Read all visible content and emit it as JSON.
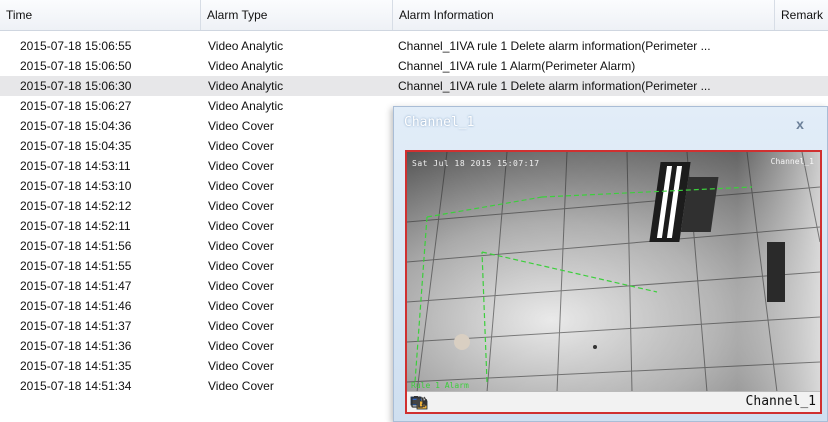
{
  "table": {
    "columns": [
      "Time",
      "Alarm Type",
      "Alarm Information",
      "Remark"
    ],
    "rows": [
      {
        "time": "2015-07-18 15:06:55",
        "type": "Video Analytic",
        "info": "Channel_1IVA rule 1 Delete alarm information(Perimeter ...",
        "remark": ""
      },
      {
        "time": "2015-07-18 15:06:50",
        "type": "Video Analytic",
        "info": "Channel_1IVA rule 1 Alarm(Perimeter Alarm)",
        "remark": ""
      },
      {
        "time": "2015-07-18 15:06:30",
        "type": "Video Analytic",
        "info": "Channel_1IVA rule 1 Delete alarm information(Perimeter ...",
        "remark": ""
      },
      {
        "time": "2015-07-18 15:06:27",
        "type": "Video Analytic",
        "info": "",
        "remark": ""
      },
      {
        "time": "2015-07-18 15:04:36",
        "type": "Video Cover",
        "info": "",
        "remark": ""
      },
      {
        "time": "2015-07-18 15:04:35",
        "type": "Video Cover",
        "info": "",
        "remark": ""
      },
      {
        "time": "2015-07-18 14:53:11",
        "type": "Video Cover",
        "info": "",
        "remark": ""
      },
      {
        "time": "2015-07-18 14:53:10",
        "type": "Video Cover",
        "info": "",
        "remark": ""
      },
      {
        "time": "2015-07-18 14:52:12",
        "type": "Video Cover",
        "info": "",
        "remark": ""
      },
      {
        "time": "2015-07-18 14:52:11",
        "type": "Video Cover",
        "info": "",
        "remark": ""
      },
      {
        "time": "2015-07-18 14:51:56",
        "type": "Video Cover",
        "info": "",
        "remark": ""
      },
      {
        "time": "2015-07-18 14:51:55",
        "type": "Video Cover",
        "info": "",
        "remark": ""
      },
      {
        "time": "2015-07-18 14:51:47",
        "type": "Video Cover",
        "info": "",
        "remark": ""
      },
      {
        "time": "2015-07-18 14:51:46",
        "type": "Video Cover",
        "info": "",
        "remark": ""
      },
      {
        "time": "2015-07-18 14:51:37",
        "type": "Video Cover",
        "info": "",
        "remark": ""
      },
      {
        "time": "2015-07-18 14:51:36",
        "type": "Video Cover",
        "info": "",
        "remark": ""
      },
      {
        "time": "2015-07-18 14:51:35",
        "type": "Video Cover",
        "info": "",
        "remark": ""
      },
      {
        "time": "2015-07-18 14:51:34",
        "type": "Video Cover",
        "info": "",
        "remark": ""
      }
    ],
    "selected_row": 2
  },
  "popup": {
    "title": "Channel_1",
    "close_label": "x",
    "video_label": "Channel_1",
    "osd_datetime": "Sat Jul 18 2015 15:07:17",
    "osd_channel": "Channel_1",
    "osd_rule": "Rule 1 Alarm",
    "toolbar_icons": [
      "talk-icon",
      "speaker-icon",
      "camera-icon"
    ]
  },
  "colors": {
    "video_border": "#d03030",
    "rule_overlay": "#3ccf3c"
  }
}
